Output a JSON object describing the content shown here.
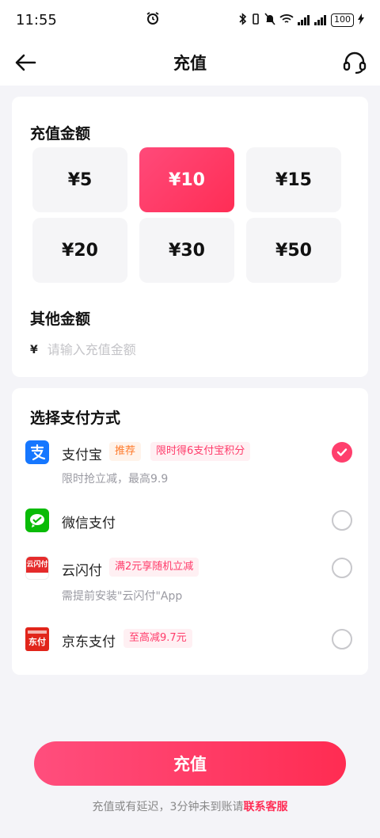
{
  "status_bar": {
    "time": "11:55",
    "alarm_icon": "alarm-clock-icon",
    "battery": "100"
  },
  "header": {
    "title": "充值",
    "back_icon": "arrow-left-icon",
    "support_icon": "headset-icon"
  },
  "amount_section": {
    "title": "充值金额",
    "options": [
      "¥5",
      "¥10",
      "¥15",
      "¥20",
      "¥30",
      "¥50"
    ],
    "selected": "¥10"
  },
  "other_amount": {
    "title": "其他金额",
    "currency_symbol": "¥",
    "placeholder": "请输入充值金额"
  },
  "payment_section": {
    "title": "选择支付方式",
    "methods": [
      {
        "name": "支付宝",
        "logo_icon": "alipay-icon",
        "tags": [
          "推荐",
          "限时得6支付宝积分"
        ],
        "subtitle": "限时抢立减，最高9.9",
        "selected": true
      },
      {
        "name": "微信支付",
        "logo_icon": "wechat-pay-icon",
        "tags": [],
        "subtitle": "",
        "selected": false
      },
      {
        "name": "云闪付",
        "logo_icon": "unionpay-quickpass-icon",
        "logo_text": "云闪付",
        "tags": [
          "满2元享随机立减"
        ],
        "subtitle": "需提前安装\"云闪付\"App",
        "selected": false
      },
      {
        "name": "京东支付",
        "logo_icon": "jd-pay-icon",
        "logo_text": "东付",
        "tags": [
          "至高减9.7元"
        ],
        "subtitle": "",
        "selected": false
      }
    ]
  },
  "submit": {
    "label": "充值"
  },
  "footer": {
    "note": "充值或有延迟，3分钟未到账请",
    "link": "联系客服"
  },
  "colors": {
    "accent": "#ff2d55",
    "background": "#f4f4f8",
    "alipay": "#1677ff",
    "wechat": "#09bb07",
    "unionpay": "#e52b2b",
    "jd": "#e1251b"
  }
}
